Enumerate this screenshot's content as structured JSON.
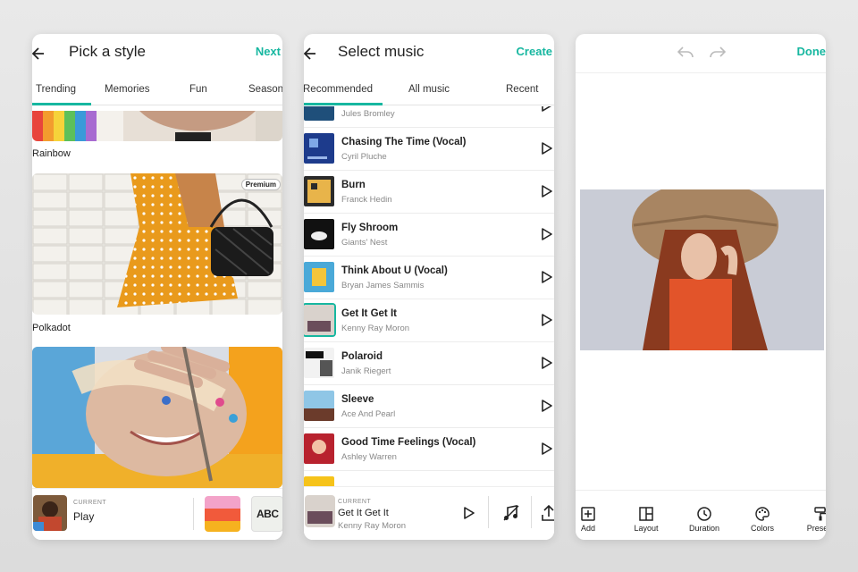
{
  "screen1": {
    "title": "Pick a style",
    "action": "Next",
    "tabs": [
      "Trending",
      "Memories",
      "Fun",
      "Season"
    ],
    "styles": [
      {
        "label": "Rainbow"
      },
      {
        "label": "Polkadot",
        "badge": "Premium"
      }
    ],
    "current": {
      "label": "CURRENT",
      "name": "Play"
    },
    "swatch_text": "ABC"
  },
  "screen2": {
    "title": "Select music",
    "action": "Create",
    "tabs": [
      "Recommended",
      "All music",
      "Recent"
    ],
    "tracks": [
      {
        "title": "",
        "artist": "Jules Bromley"
      },
      {
        "title": "Chasing The Time (Vocal)",
        "artist": "Cyril Pluche"
      },
      {
        "title": "Burn",
        "artist": "Franck Hedin"
      },
      {
        "title": "Fly Shroom",
        "artist": "Giants' Nest"
      },
      {
        "title": "Think About U (Vocal)",
        "artist": "Bryan James Sammis"
      },
      {
        "title": "Get It Get It",
        "artist": "Kenny Ray Moron"
      },
      {
        "title": "Polaroid",
        "artist": "Janik Riegert"
      },
      {
        "title": "Sleeve",
        "artist": "Ace And Pearl"
      },
      {
        "title": "Good Time Feelings (Vocal)",
        "artist": "Ashley Warren"
      }
    ],
    "current": {
      "label": "CURRENT",
      "title": "Get It Get It",
      "artist": "Kenny Ray Moron"
    }
  },
  "screen3": {
    "action": "Done",
    "tools": [
      "Add",
      "Layout",
      "Duration",
      "Colors",
      "Presets"
    ]
  },
  "colors": {
    "accent": "#17b7a0"
  }
}
